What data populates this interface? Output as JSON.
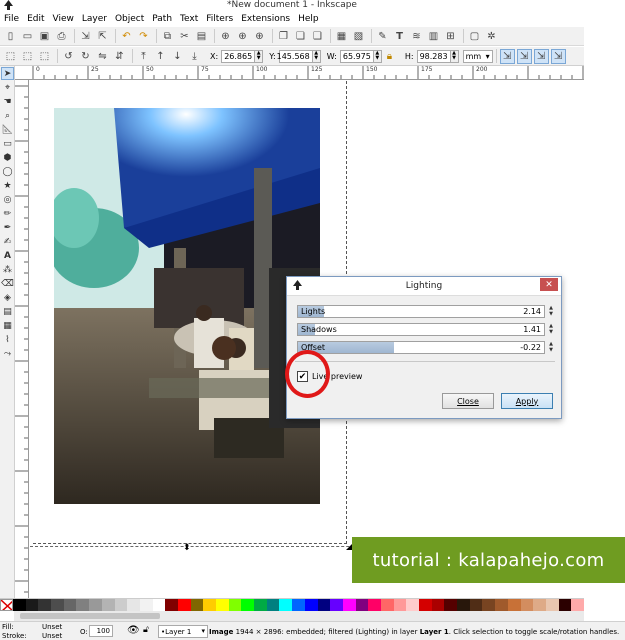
{
  "window": {
    "title": "*New document 1 - Inkscape"
  },
  "menu": [
    "File",
    "Edit",
    "View",
    "Layer",
    "Object",
    "Path",
    "Text",
    "Filters",
    "Extensions",
    "Help"
  ],
  "toolbar": {
    "x_label": "X:",
    "x_value": "26.865",
    "y_label": "Y:",
    "y_value": "145.568",
    "w_label": "W:",
    "w_value": "65.975",
    "h_label": "H:",
    "h_value": "98.283",
    "unit": "mm"
  },
  "ruler_top": [
    "0",
    "25",
    "50",
    "75",
    "100",
    "125",
    "150",
    "175",
    "200"
  ],
  "ruler_left": [
    "25",
    "50",
    "75",
    "100",
    "125",
    "150",
    "175",
    "200",
    "225",
    "250",
    "275"
  ],
  "dialog": {
    "title": "Lighting",
    "lights_label": "Lights",
    "lights_value": "2.14",
    "lights_fraction": 0.107,
    "shadows_label": "Shadows",
    "shadows_value": "1.41",
    "shadows_fraction": 0.07,
    "offset_label": "Offset",
    "offset_value": "-0.22",
    "offset_fraction": 0.39,
    "live_preview_label": "Live preview",
    "live_preview_checked": true,
    "close_label": "Close",
    "apply_label": "Apply"
  },
  "watermark": "tutorial : kalapahejo.com",
  "status": {
    "fill_label": "Fill:",
    "fill_value": "Unset",
    "stroke_label": "Stroke:",
    "stroke_value": "Unset",
    "opacity_label": "O:",
    "opacity_value": "100",
    "layer": "•Layer 1",
    "message_strong1": "Image",
    "message_mid": " 1944 × 2896: embedded; filtered (Lighting) in layer ",
    "message_strong2": "Layer 1",
    "message_tail": ". Click selection to toggle scale/rotation handles."
  },
  "palette_colors": [
    "#000000",
    "#1a1a1a",
    "#333333",
    "#4d4d4d",
    "#666666",
    "#808080",
    "#999999",
    "#b3b3b3",
    "#cccccc",
    "#e6e6e6",
    "#f2f2f2",
    "#ffffff",
    "#800000",
    "#ff0000",
    "#806600",
    "#ffcc00",
    "#ffff00",
    "#80ff00",
    "#00ff00",
    "#00aa44",
    "#008080",
    "#00ffff",
    "#0066ff",
    "#0000ff",
    "#000080",
    "#6600ff",
    "#ff00ff",
    "#800080",
    "#ff0066",
    "#ff6666",
    "#ff9999",
    "#ffcccc",
    "#d40000",
    "#aa0000",
    "#550000",
    "#28170b",
    "#502d16",
    "#784421",
    "#a05a2c",
    "#c87137",
    "#d38d5f",
    "#deaa87",
    "#e9c6af",
    "#2b0000",
    "#ffaaaa"
  ]
}
